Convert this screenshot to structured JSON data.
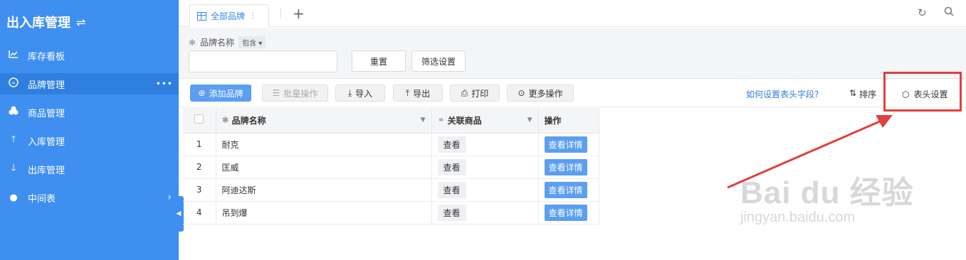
{
  "sidebar": {
    "title": "出入库管理",
    "items": [
      {
        "label": "库存看板",
        "icon": "chart-line-icon"
      },
      {
        "label": "品牌管理",
        "icon": "brand-icon",
        "active": true
      },
      {
        "label": "商品管理",
        "icon": "goods-icon"
      },
      {
        "label": "入库管理",
        "icon": "arrow-up-icon"
      },
      {
        "label": "出库管理",
        "icon": "arrow-down-icon"
      },
      {
        "label": "中间表",
        "icon": "dot-icon"
      }
    ]
  },
  "tabs": [
    {
      "label": "全部品牌"
    }
  ],
  "filter": {
    "field_label": "品牌名称",
    "operator": "包含",
    "input_value": "",
    "reset_label": "重置",
    "settings_label": "筛选设置"
  },
  "toolbar": {
    "add_label": "添加品牌",
    "batch_label": "批量操作",
    "import_label": "导入",
    "export_label": "导出",
    "print_label": "打印",
    "more_label": "更多操作",
    "help_link": "如何设置表头字段?",
    "sort_label": "排序",
    "header_settings_label": "表头设置"
  },
  "table": {
    "columns": [
      "品牌名称",
      "关联商品",
      "操作"
    ],
    "rows": [
      {
        "index": "1",
        "name": "耐克",
        "view": "查看",
        "detail": "查看详情"
      },
      {
        "index": "2",
        "name": "匡威",
        "view": "查看",
        "detail": "查看详情"
      },
      {
        "index": "3",
        "name": "阿迪达斯",
        "view": "查看",
        "detail": "查看详情"
      },
      {
        "index": "4",
        "name": "吊到爆",
        "view": "查看",
        "detail": "查看详情"
      }
    ]
  },
  "watermark": {
    "brand": "Bai du 经验",
    "url": "jingyan.baidu.com"
  },
  "colors": {
    "sidebar": "#3f8ff0",
    "accent": "#5b9ef2",
    "highlight": "#e0403f"
  }
}
